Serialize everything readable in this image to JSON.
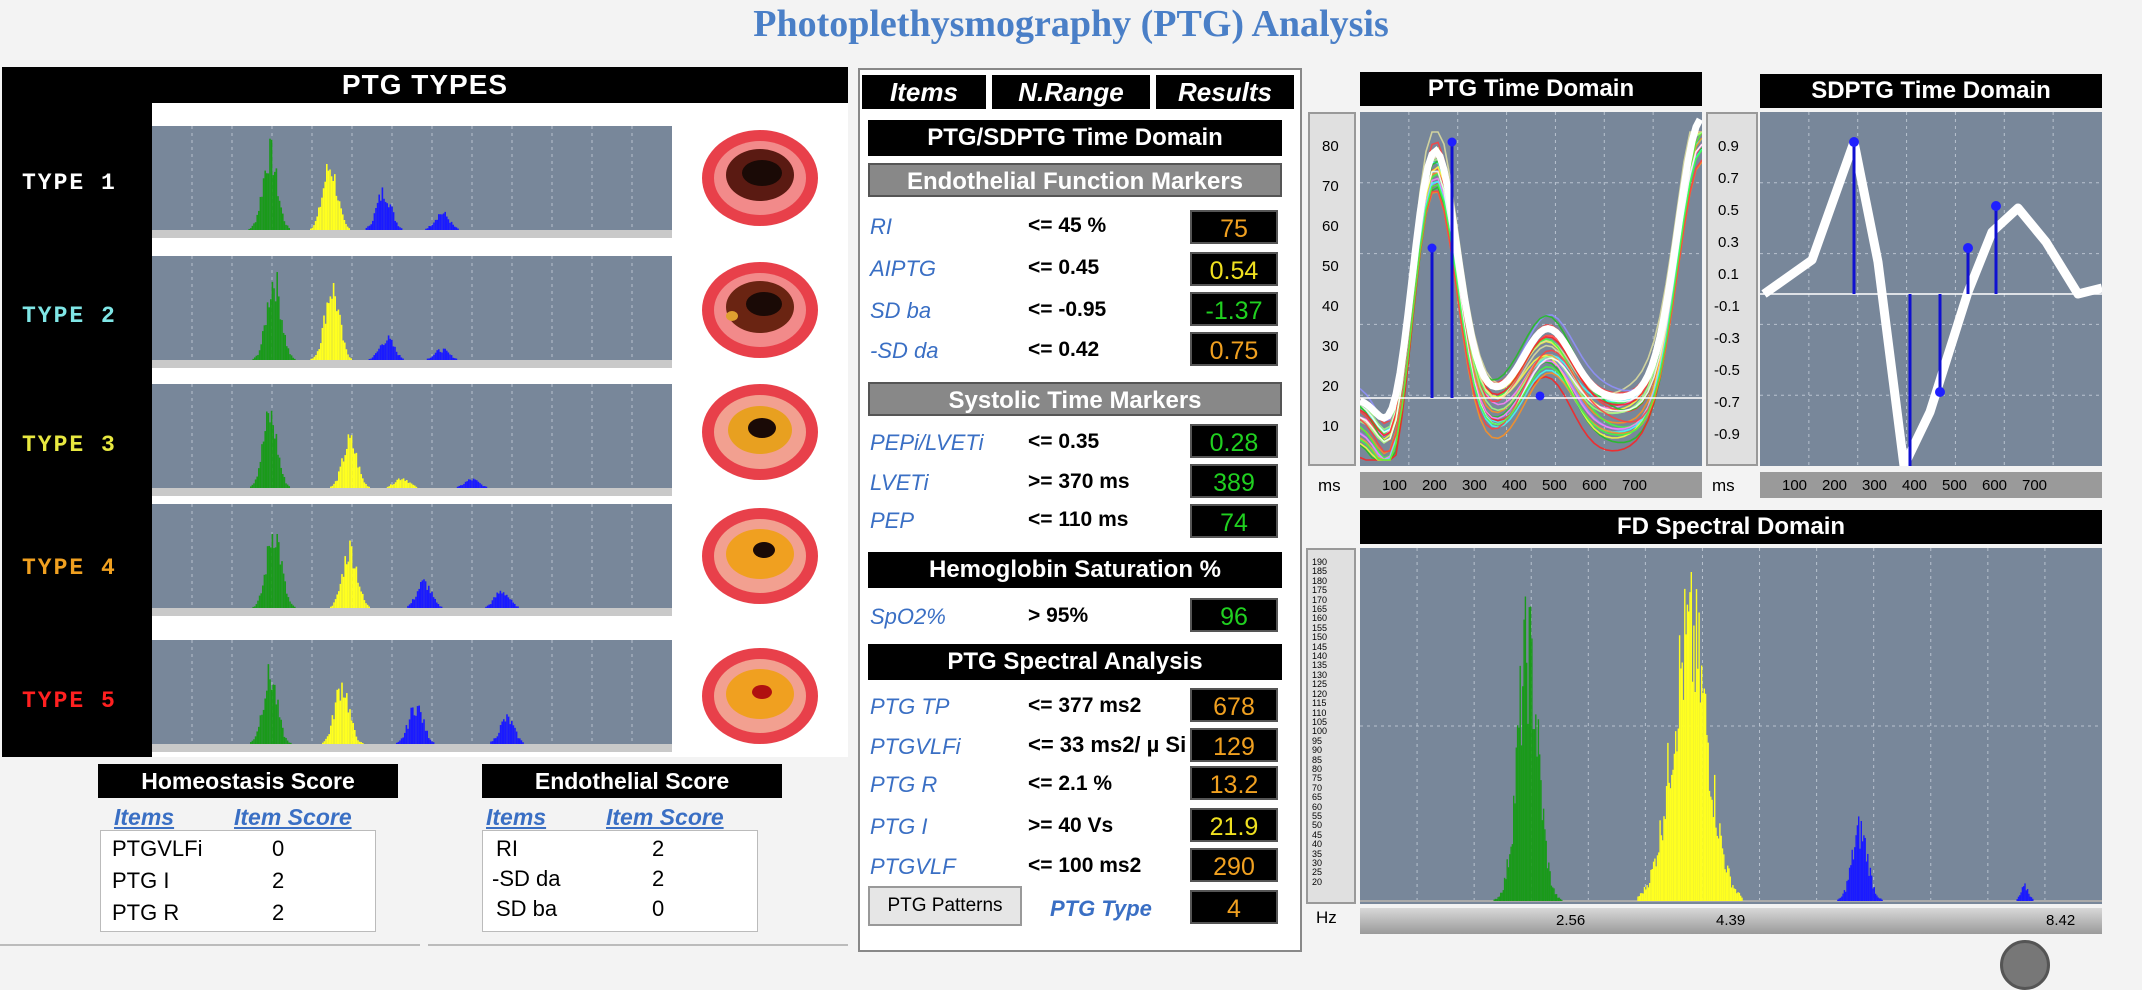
{
  "app": {
    "title": "Photoplethysmography (PTG) Analysis"
  },
  "types_panel": {
    "header": "PTG TYPES",
    "types": [
      {
        "label": "TYPE 1",
        "color": "#ffffff"
      },
      {
        "label": "TYPE 2",
        "color": "#7fe6e6"
      },
      {
        "label": "TYPE 3",
        "color": "#e8e840"
      },
      {
        "label": "TYPE 4",
        "color": "#f0a020"
      },
      {
        "label": "TYPE 5",
        "color": "#ff2020"
      }
    ]
  },
  "homeostasis": {
    "title": "Homeostasis Score",
    "col_items": "Items",
    "col_score": "Item Score",
    "rows": [
      {
        "item": "PTGVLFi",
        "score": "0"
      },
      {
        "item": "PTG I",
        "score": "2"
      },
      {
        "item": "PTG R",
        "score": "2"
      }
    ]
  },
  "endothelial": {
    "title": "Endothelial Score",
    "col_items": "Items",
    "col_score": "Item Score",
    "rows": [
      {
        "item": "RI",
        "score": "2"
      },
      {
        "item": "-SD da",
        "score": "2"
      },
      {
        "item": "SD ba",
        "score": "0"
      }
    ]
  },
  "table": {
    "headers": {
      "items": "Items",
      "range": "N.Range",
      "results": "Results"
    },
    "sections": {
      "time_domain": "PTG/SDPTG Time Domain",
      "endothelial": "Endothelial Function Markers",
      "systolic": "Systolic Time Markers",
      "hemoglobin": "Hemoglobin Saturation %",
      "spectral": "PTG Spectral Analysis"
    },
    "endothelial_rows": [
      {
        "item": "RI",
        "range": "<= 45 %",
        "result": "75",
        "color": "#f0a020"
      },
      {
        "item": "AIPTG",
        "range": "<= 0.45",
        "result": "0.54",
        "color": "#f0e020"
      },
      {
        "item": "SD ba",
        "range": "<= -0.95",
        "result": "-1.37",
        "color": "#20d020"
      },
      {
        "item": "-SD da",
        "range": "<= 0.42",
        "result": "0.75",
        "color": "#f0a020"
      }
    ],
    "systolic_rows": [
      {
        "item": "PEPi/LVETi",
        "range": "<= 0.35",
        "result": "0.28",
        "color": "#20d020"
      },
      {
        "item": "LVETi",
        "range": ">= 370 ms",
        "result": "389",
        "color": "#20d020"
      },
      {
        "item": "PEP",
        "range": "<= 110 ms",
        "result": "74",
        "color": "#20d020"
      }
    ],
    "hemoglobin_rows": [
      {
        "item": "SpO2%",
        "range": "> 95%",
        "result": "96",
        "color": "#20d020"
      }
    ],
    "spectral_rows": [
      {
        "item": "PTG TP",
        "range": "<= 377 ms2",
        "result": "678",
        "color": "#f0a020"
      },
      {
        "item": "PTGVLFi",
        "range": "<= 33 ms2/ µ Si",
        "result": "129",
        "color": "#f0a020"
      },
      {
        "item": "PTG R",
        "range": "<= 2.1 %",
        "result": "13.2",
        "color": "#f0a020"
      },
      {
        "item": "PTG I",
        "range": ">= 40 Vs",
        "result": "21.9",
        "color": "#f0e020"
      },
      {
        "item": "PTGVLF",
        "range": "<= 100 ms2",
        "result": "290",
        "color": "#f0a020"
      }
    ],
    "patterns_button": "PTG Patterns",
    "ptg_type_label": "PTG Type",
    "ptg_type_value": "4",
    "ptg_type_color": "#f0a020"
  },
  "ptg_time": {
    "title": "PTG Time Domain",
    "y_ticks": [
      "80",
      "70",
      "60",
      "50",
      "40",
      "30",
      "20",
      "10"
    ],
    "x_ticks": [
      "100",
      "200",
      "300",
      "400",
      "500",
      "600",
      "700"
    ],
    "x_unit": "ms"
  },
  "sdptg_time": {
    "title": "SDPTG Time Domain",
    "y_ticks": [
      "0.9",
      "0.7",
      "0.5",
      "0.3",
      "0.1",
      "-0.1",
      "-0.3",
      "-0.5",
      "-0.7",
      "-0.9"
    ],
    "x_ticks": [
      "100",
      "200",
      "300",
      "400",
      "500",
      "600",
      "700"
    ],
    "x_unit": "ms"
  },
  "fd_spectral": {
    "title": "FD Spectral Domain",
    "x_ticks": [
      "2.56",
      "4.39",
      "8.42"
    ],
    "x_unit": "Hz",
    "y_ticks": [
      "190",
      "185",
      "180",
      "175",
      "170",
      "165",
      "160",
      "155",
      "150",
      "145",
      "140",
      "135",
      "130",
      "125",
      "120",
      "115",
      "110",
      "105",
      "100",
      "95",
      "90",
      "85",
      "80",
      "75",
      "70",
      "65",
      "60",
      "55",
      "50",
      "45",
      "40",
      "35",
      "30",
      "25",
      "20"
    ]
  },
  "colors": {
    "vlf": "#1a9a1a",
    "lf": "#ffff20",
    "hf": "#1a1aff",
    "accent": "#3a6fc4"
  }
}
